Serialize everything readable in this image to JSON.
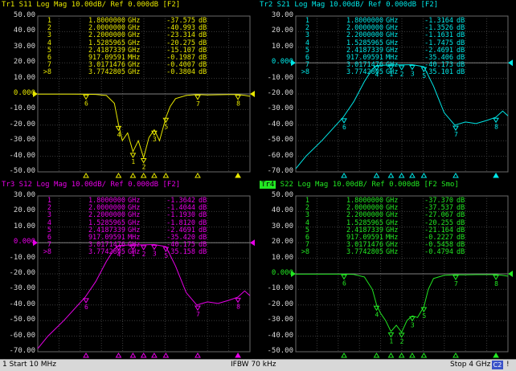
{
  "window": {
    "status_start": "1  Start 10 MHz",
    "status_ifbw": "IFBW 70 kHz",
    "status_stop": "Stop 4 GHz",
    "status_channel": "C2",
    "status_bang": "!"
  },
  "panes": [
    {
      "id": "tr1",
      "color": "#e8e800",
      "header_badge": "",
      "header": "Tr1 S11 Log Mag 10.00dB/ Ref 0.000dB [F2]",
      "ylabels": [
        "50.00",
        "40.00",
        "30.00",
        "20.00",
        "10.00",
        "0.000",
        "-10.00",
        "-20.00",
        "-30.00",
        "-40.00",
        "-50.00"
      ],
      "ref_index": 5,
      "markers": [
        {
          "id": "1",
          "freq": "1.8000000",
          "unit": "GHz",
          "value": "-37.575",
          "db": "dB"
        },
        {
          "id": "2",
          "freq": "2.0000000",
          "unit": "GHz",
          "value": "-40.993",
          "db": "dB"
        },
        {
          "id": "3",
          "freq": "2.2000000",
          "unit": "GHz",
          "value": "-23.314",
          "db": "dB"
        },
        {
          "id": "4",
          "freq": "1.5285965",
          "unit": "GHz",
          "value": "-20.275",
          "db": "dB"
        },
        {
          "id": "5",
          "freq": "2.4187339",
          "unit": "GHz",
          "value": "-15.107",
          "db": "dB"
        },
        {
          "id": "6",
          "freq": "917.09591",
          "unit": "MHz",
          "value": "-0.1987",
          "db": "dB"
        },
        {
          "id": "7",
          "freq": "3.0171476",
          "unit": "GHz",
          "value": "-0.4007",
          "db": "dB"
        },
        {
          "id": ">8",
          "freq": "3.7742805",
          "unit": "GHz",
          "value": "-0.3804",
          "db": "dB"
        }
      ]
    },
    {
      "id": "tr2",
      "color": "#00e8e8",
      "header_badge": "",
      "header": "Tr2 S21 Log Mag 10.00dB/ Ref 0.000dB [F2]",
      "ylabels": [
        "30.00",
        "20.00",
        "10.00",
        "0.000",
        "-10.00",
        "-20.00",
        "-30.00",
        "-40.00",
        "-50.00",
        "-60.00",
        "-70.00"
      ],
      "ref_index": 3,
      "markers": [
        {
          "id": "1",
          "freq": "1.8000000",
          "unit": "GHz",
          "value": "-1.3164",
          "db": "dB"
        },
        {
          "id": "2",
          "freq": "2.0000000",
          "unit": "GHz",
          "value": "-1.3526",
          "db": "dB"
        },
        {
          "id": "3",
          "freq": "2.2000000",
          "unit": "GHz",
          "value": "-1.1631",
          "db": "dB"
        },
        {
          "id": "4",
          "freq": "1.5285965",
          "unit": "GHz",
          "value": "-1.7475",
          "db": "dB"
        },
        {
          "id": "5",
          "freq": "2.4187339",
          "unit": "GHz",
          "value": "-2.4691",
          "db": "dB"
        },
        {
          "id": "6",
          "freq": "917.09591",
          "unit": "MHz",
          "value": "-35.406",
          "db": "dB"
        },
        {
          "id": "7",
          "freq": "3.0171476",
          "unit": "GHz",
          "value": "-40.173",
          "db": "dB"
        },
        {
          "id": ">8",
          "freq": "3.7742805",
          "unit": "GHz",
          "value": "-35.101",
          "db": "dB"
        }
      ]
    },
    {
      "id": "tr3",
      "color": "#e800e8",
      "header_badge": "",
      "header": "Tr3 S12 Log Mag 10.00dB/ Ref 0.000dB [F2]",
      "ylabels": [
        "30.00",
        "20.00",
        "10.00",
        "0.000",
        "-10.00",
        "-20.00",
        "-30.00",
        "-40.00",
        "-50.00",
        "-60.00",
        "-70.00"
      ],
      "ref_index": 3,
      "markers": [
        {
          "id": "1",
          "freq": "1.8000000",
          "unit": "GHz",
          "value": "-1.3642",
          "db": "dB"
        },
        {
          "id": "2",
          "freq": "2.0000000",
          "unit": "GHz",
          "value": "-1.4044",
          "db": "dB"
        },
        {
          "id": "3",
          "freq": "2.2000000",
          "unit": "GHz",
          "value": "-1.1930",
          "db": "dB"
        },
        {
          "id": "4",
          "freq": "1.5285965",
          "unit": "GHz",
          "value": "-1.8120",
          "db": "dB"
        },
        {
          "id": "5",
          "freq": "2.4187339",
          "unit": "GHz",
          "value": "-2.4691",
          "db": "dB"
        },
        {
          "id": "6",
          "freq": "917.09591",
          "unit": "MHz",
          "value": "-35.420",
          "db": "dB"
        },
        {
          "id": "7",
          "freq": "3.0171476",
          "unit": "GHz",
          "value": "-40.175",
          "db": "dB"
        },
        {
          "id": ">8",
          "freq": "3.7742805",
          "unit": "GHz",
          "value": "-35.158",
          "db": "dB"
        }
      ]
    },
    {
      "id": "tr4",
      "color": "#22e822",
      "header_badge": "Tr4",
      "header": " S22 Log Mag 10.00dB/ Ref 0.000dB [F2 Smo]",
      "ylabels": [
        "50.00",
        "40.00",
        "30.00",
        "20.00",
        "10.00",
        "0.000",
        "-10.00",
        "-20.00",
        "-30.00",
        "-40.00",
        "-50.00"
      ],
      "ref_index": 5,
      "markers": [
        {
          "id": "1",
          "freq": "1.8000000",
          "unit": "GHz",
          "value": "-37.370",
          "db": "dB"
        },
        {
          "id": "2",
          "freq": "2.0000000",
          "unit": "GHz",
          "value": "-37.537",
          "db": "dB"
        },
        {
          "id": "3",
          "freq": "2.2000000",
          "unit": "GHz",
          "value": "-27.067",
          "db": "dB"
        },
        {
          "id": "4",
          "freq": "1.5285965",
          "unit": "GHz",
          "value": "-20.255",
          "db": "dB"
        },
        {
          "id": "5",
          "freq": "2.4187339",
          "unit": "GHz",
          "value": "-21.164",
          "db": "dB"
        },
        {
          "id": "6",
          "freq": "917.09591",
          "unit": "MHz",
          "value": "-0.2227",
          "db": "dB"
        },
        {
          "id": "7",
          "freq": "3.0171476",
          "unit": "GHz",
          "value": "-0.5458",
          "db": "dB"
        },
        {
          "id": ">8",
          "freq": "3.7742805",
          "unit": "GHz",
          "value": "-0.4794",
          "db": "dB"
        }
      ]
    }
  ],
  "chart_data": [
    {
      "type": "line",
      "title": "Tr1 S11 Log Mag 10.00dB/ Ref 0.000dB [F2]",
      "ylim": [
        -50,
        50
      ],
      "xlim_ghz": [
        0.01,
        4
      ],
      "x": [
        0.01,
        0.3,
        0.6,
        0.9,
        1.1,
        1.3,
        1.45,
        1.53,
        1.6,
        1.7,
        1.8,
        1.9,
        2.0,
        2.1,
        2.2,
        2.3,
        2.42,
        2.5,
        2.6,
        2.8,
        3.0,
        3.2,
        3.4,
        3.6,
        3.77,
        3.9,
        4.0
      ],
      "series": [
        {
          "values": [
            -0.1,
            -0.1,
            -0.1,
            -0.2,
            -0.3,
            -1,
            -6,
            -20,
            -30,
            -25,
            -37,
            -30,
            -41,
            -28,
            -23,
            -30,
            -15,
            -8,
            -3,
            -1,
            -0.4,
            -0.6,
            -0.5,
            -0.4,
            -0.38,
            -0.9,
            -1.5
          ]
        }
      ]
    },
    {
      "type": "line",
      "title": "Tr2 S21 Log Mag 10.00dB/ Ref 0.000dB [F2]",
      "ylim": [
        -70,
        30
      ],
      "xlim_ghz": [
        0.01,
        4
      ],
      "x": [
        0.01,
        0.2,
        0.5,
        0.9,
        1.1,
        1.3,
        1.45,
        1.53,
        1.8,
        2.0,
        2.2,
        2.42,
        2.6,
        2.8,
        3.0,
        3.2,
        3.4,
        3.6,
        3.77,
        3.9,
        4.0
      ],
      "series": [
        {
          "values": [
            -68,
            -60,
            -50,
            -35,
            -25,
            -12,
            -4,
            -1.7,
            -1.3,
            -1.35,
            -1.16,
            -2.5,
            -15,
            -32,
            -40,
            -38,
            -39,
            -37,
            -35,
            -31,
            -34
          ]
        }
      ]
    },
    {
      "type": "line",
      "title": "Tr3 S12 Log Mag 10.00dB/ Ref 0.000dB [F2]",
      "ylim": [
        -70,
        30
      ],
      "xlim_ghz": [
        0.01,
        4
      ],
      "x": [
        0.01,
        0.2,
        0.5,
        0.9,
        1.1,
        1.3,
        1.45,
        1.53,
        1.8,
        2.0,
        2.2,
        2.42,
        2.6,
        2.8,
        3.0,
        3.2,
        3.4,
        3.6,
        3.77,
        3.9,
        4.0
      ],
      "series": [
        {
          "values": [
            -68,
            -60,
            -50,
            -35,
            -25,
            -12,
            -4,
            -1.8,
            -1.36,
            -1.4,
            -1.19,
            -2.5,
            -15,
            -32,
            -40,
            -38,
            -39,
            -37,
            -35,
            -31,
            -34
          ]
        }
      ]
    },
    {
      "type": "line",
      "title": "Tr4 S22 Log Mag 10.00dB/ Ref 0.000dB [F2 Smo]",
      "ylim": [
        -50,
        50
      ],
      "xlim_ghz": [
        0.01,
        4
      ],
      "x": [
        0.01,
        0.3,
        0.6,
        0.9,
        1.1,
        1.3,
        1.45,
        1.53,
        1.6,
        1.7,
        1.8,
        1.9,
        2.0,
        2.1,
        2.2,
        2.3,
        2.42,
        2.5,
        2.6,
        2.8,
        3.0,
        3.2,
        3.4,
        3.6,
        3.77,
        3.9,
        4.0
      ],
      "series": [
        {
          "values": [
            -0.2,
            -0.2,
            -0.2,
            -0.22,
            -0.4,
            -2,
            -10,
            -20,
            -25,
            -30,
            -37,
            -33,
            -37.5,
            -30,
            -27,
            -28,
            -21,
            -10,
            -3,
            -1,
            -0.55,
            -0.6,
            -0.5,
            -0.5,
            -0.48,
            -1,
            -1.5
          ]
        }
      ]
    }
  ]
}
